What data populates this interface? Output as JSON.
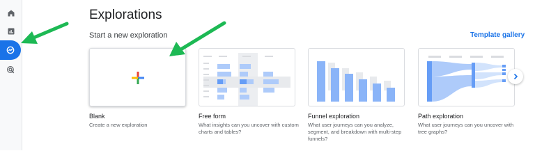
{
  "page": {
    "title": "Explorations",
    "section_title": "Start a new exploration",
    "template_gallery_label": "Template gallery"
  },
  "nav": {
    "items": [
      {
        "icon": "home-icon"
      },
      {
        "icon": "reports-icon"
      },
      {
        "icon": "explore-icon",
        "active": true
      },
      {
        "icon": "advertising-icon"
      }
    ]
  },
  "templates": [
    {
      "title": "Blank",
      "description": "Create a new exploration"
    },
    {
      "title": "Free form",
      "description": "What insights can you uncover with custom charts and tables?"
    },
    {
      "title": "Funnel exploration",
      "description": "What user journeys can you analyze, segment, and breakdown with multi-step funnels?"
    },
    {
      "title": "Path exploration",
      "description": "What user journeys can you uncover with tree graphs?"
    }
  ],
  "colors": {
    "accent": "#1a73e8",
    "annotation_arrow": "#1db954",
    "thumb_blue": "#8ab4f8"
  }
}
